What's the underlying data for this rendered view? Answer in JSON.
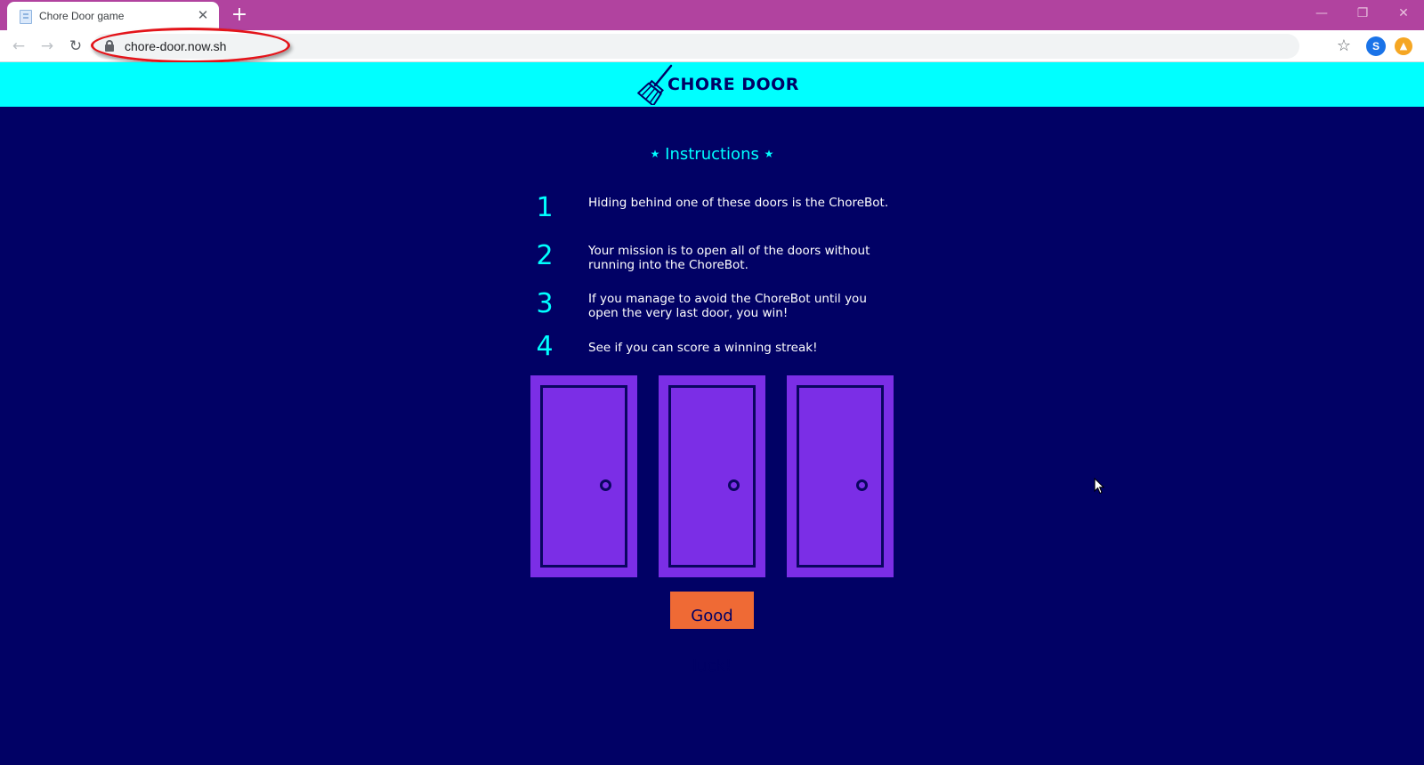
{
  "browser": {
    "tab_title": "Chore Door game",
    "tab_close": "✕",
    "new_tab": "+",
    "url": "chore-door.now.sh",
    "avatar_letter": "S",
    "back": "←",
    "forward": "→",
    "reload": "↻",
    "bookmark": "☆",
    "minimize": "—",
    "restore": "❐",
    "close": "✕"
  },
  "header": {
    "title": "CHORE DOOR"
  },
  "instructions": {
    "heading": "Instructions",
    "star": "★",
    "steps": [
      {
        "num": "1",
        "text": "Hiding behind one of these doors is the ChoreBot."
      },
      {
        "num": "2",
        "text": "Your mission is to open all of the doors without running into the ChoreBot."
      },
      {
        "num": "3",
        "text": "If you manage to avoid the ChoreBot until you open the very last door, you win!"
      },
      {
        "num": "4",
        "text": "See if you can score a winning streak!"
      }
    ]
  },
  "game": {
    "door_count": 3,
    "button_label": "Good luck!"
  },
  "colors": {
    "background": "#010165",
    "header": "#00ffff",
    "door": "#7b2ee6",
    "button": "#ef6a35",
    "tabstrip": "#b1439f",
    "annotation": "#e3141a"
  }
}
